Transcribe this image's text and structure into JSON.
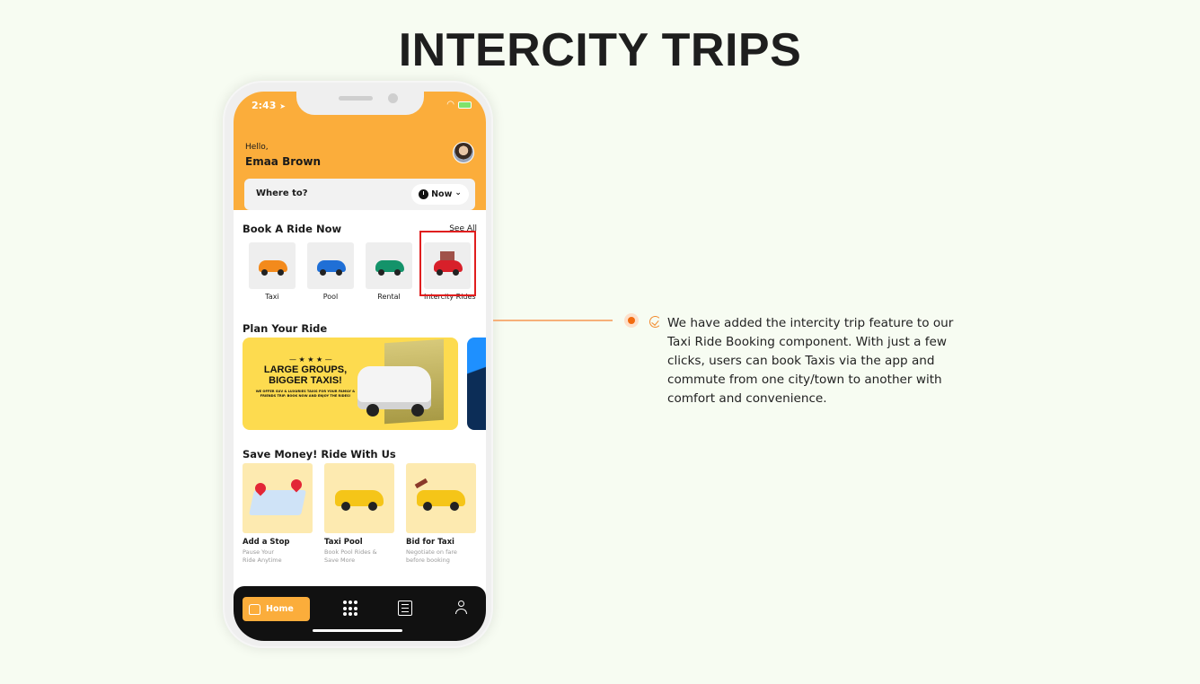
{
  "page": {
    "title": "INTERCITY TRIPS",
    "description": "We have added the intercity trip feature to our Taxi Ride Booking component. With just a few clicks, users can book Taxis via the app and commute from one city/town to another with comfort and convenience.",
    "accent_color": "#f26b10"
  },
  "phone": {
    "status_bar": {
      "time": "2:43",
      "location_icon": "➤",
      "wifi_icon": "wifi-icon",
      "battery_icon": "battery-charging-icon"
    },
    "header": {
      "greeting": "Hello,",
      "user_name": "Emaa Brown",
      "brand_color": "#fbad3b"
    },
    "search": {
      "label": "Where to?",
      "time_option": "Now",
      "chevron": "⌄"
    },
    "book_ride": {
      "title": "Book A Ride Now",
      "see_all": "See All",
      "options": [
        {
          "label": "Taxi",
          "color": "#f38a1c"
        },
        {
          "label": "Pool",
          "color": "#1f6fd6"
        },
        {
          "label": "Rental",
          "color": "#14936a"
        },
        {
          "label": "Intercity Rides",
          "color": "#d8202a",
          "highlighted": true
        }
      ]
    },
    "plan_ride": {
      "title": "Plan Your Ride",
      "banner": {
        "stars": "— ★ ★ ★ —",
        "headline": "LARGE GROUPS, BIGGER TAXIS!",
        "subtext": "WE OFFER SUV & LUXURIES TAXIS FOR YOUR FAMILY & FRIENDS TRIP. BOOK NOW AND ENJOY THE RIDES!"
      }
    },
    "save_money": {
      "title": "Save Money! Ride With Us",
      "cards": [
        {
          "title": "Add a Stop",
          "subtitle": "Pause Your Ride Anytime"
        },
        {
          "title": "Taxi Pool",
          "subtitle": "Book Pool Rides & Save More"
        },
        {
          "title": "Bid for Taxi",
          "subtitle": "Negotiate on fare before booking"
        }
      ]
    },
    "tabbar": {
      "home_label": "Home"
    }
  }
}
